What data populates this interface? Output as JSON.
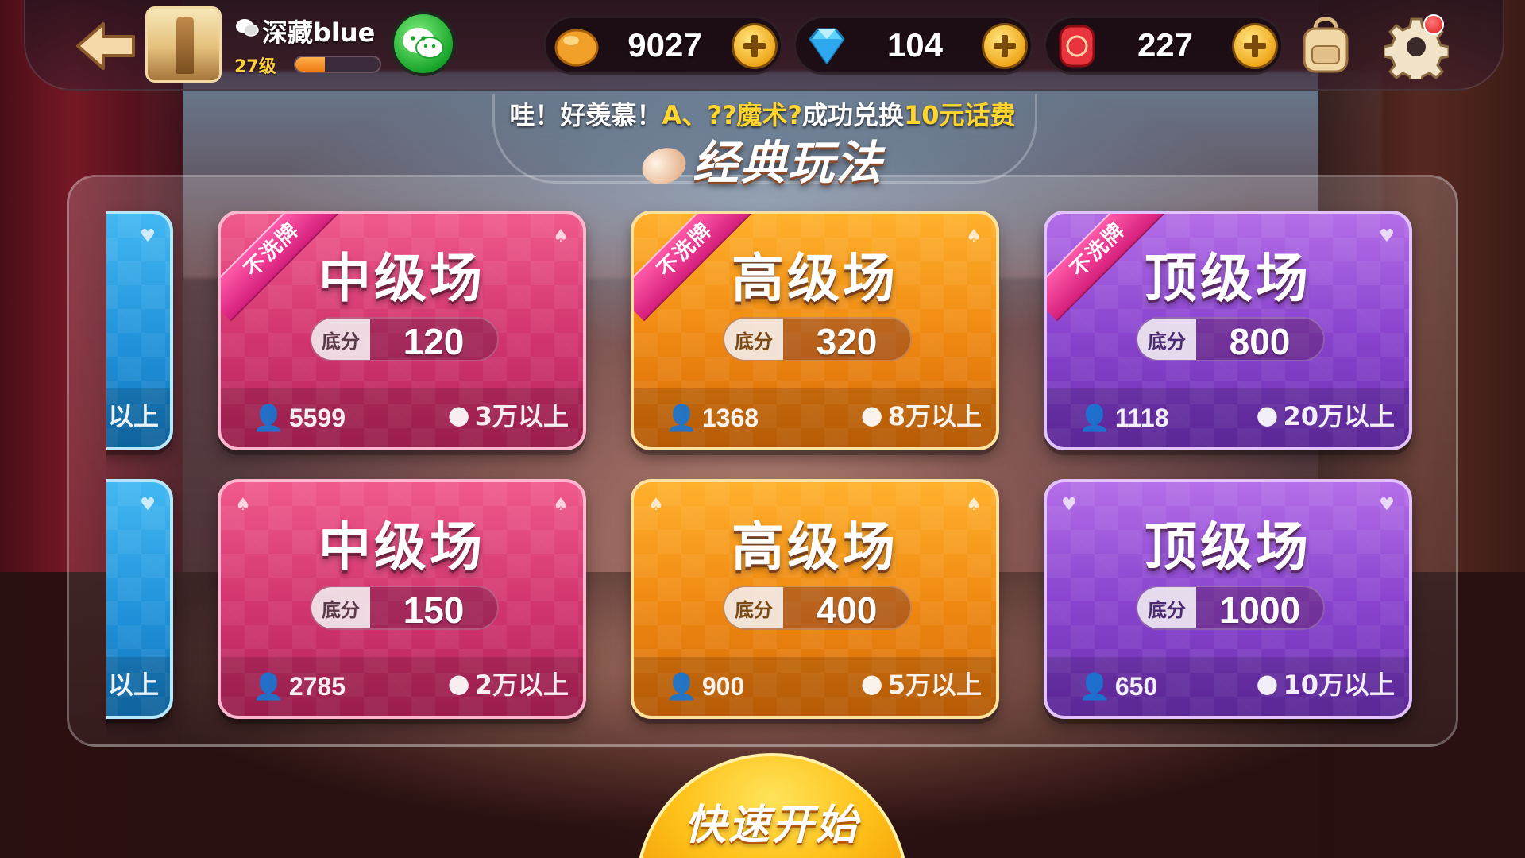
{
  "topbar": {
    "username": "深藏blue",
    "level": "27级",
    "xp_fraction": 0.35,
    "currencies": [
      {
        "icon": "bean-coin-icon",
        "value": "9027"
      },
      {
        "icon": "diamond-icon",
        "value": "104"
      },
      {
        "icon": "lucky-token-icon",
        "value": "227"
      }
    ],
    "settings_has_notification": true
  },
  "marquee": {
    "prefix": "哇！好羡慕！",
    "player": "A、??魔术?",
    "middle": "成功兑换",
    "reward": "10元话费"
  },
  "mode_title": "经典玩法",
  "rooms": {
    "row1": [
      {
        "edge_text": "以上"
      },
      {
        "name": "中级场",
        "score_label": "底分",
        "score": "120",
        "players": "5599",
        "min_beans": "3万以上",
        "ribbon": "不洗牌"
      },
      {
        "name": "高级场",
        "score_label": "底分",
        "score": "320",
        "players": "1368",
        "min_beans": "8万以上",
        "ribbon": "不洗牌"
      },
      {
        "name": "顶级场",
        "score_label": "底分",
        "score": "800",
        "players": "1118",
        "min_beans": "20万以上",
        "ribbon": "不洗牌"
      }
    ],
    "row2": [
      {
        "edge_text": "以上"
      },
      {
        "name": "中级场",
        "score_label": "底分",
        "score": "150",
        "players": "2785",
        "min_beans": "2万以上"
      },
      {
        "name": "高级场",
        "score_label": "底分",
        "score": "400",
        "players": "900",
        "min_beans": "5万以上"
      },
      {
        "name": "顶级场",
        "score_label": "底分",
        "score": "1000",
        "players": "650",
        "min_beans": "10万以上"
      }
    ]
  },
  "quick_start": "快速开始",
  "colors": {
    "pink": "#d33670",
    "orange": "#f08a12",
    "purple": "#8a44cf",
    "blue": "#1e8fd8",
    "highlight": "#ffd52e"
  }
}
